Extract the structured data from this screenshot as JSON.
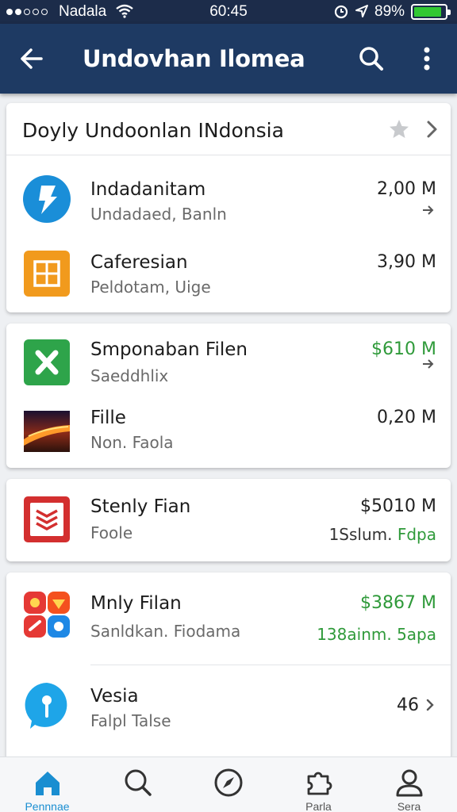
{
  "status_bar": {
    "carrier": "Nadala",
    "time": "60:45",
    "battery": "89%",
    "battery_level": 0.89,
    "battery_color": "#32c832"
  },
  "app_bar": {
    "title": "Undovhan Ilomea",
    "background": "#1e3a63",
    "icons": [
      "back-arrow-icon",
      "search-icon",
      "more-vert-icon"
    ]
  },
  "section": {
    "header": "Doyly Undoonlan INdonsia",
    "header_icons": [
      "star-icon",
      "chevron-right-icon"
    ]
  },
  "cards": [
    {
      "items": [
        {
          "icon": "lightning-app-icon",
          "name": "Indadanitam",
          "subtitle": "Undadaed, Banln",
          "value": "2,00 M",
          "trailing": "arrow-icon"
        },
        {
          "icon": "grid-app-icon",
          "name": "Caferesian",
          "subtitle": "Peldotam, Uige",
          "value": "3,90 M"
        }
      ]
    },
    {
      "items": [
        {
          "icon": "excel-app-icon",
          "name": "Smponaban Filen",
          "subtitle": "Saeddhlix",
          "value": "$610 M",
          "value_green": true,
          "trailing": "arrow-icon"
        },
        {
          "icon": "photo-thumbnail-icon",
          "name": "Fille",
          "subtitle": "Non. Faola",
          "value": "0,20 M"
        }
      ]
    },
    {
      "items": [
        {
          "icon": "document-app-icon",
          "name": "Stenly Fian",
          "subtitle": "Foole",
          "value": "$5010 M",
          "secondary_prefix": "1Sslum.",
          "secondary_green": "Fdpa"
        }
      ]
    },
    {
      "items": [
        {
          "icon": "multicolor-app-icon",
          "name": "Mnly Filan",
          "subtitle": "Sanldkan. Fiodama",
          "value": "$3867 M",
          "value_green": true,
          "secondary_green": "138ainm. 5apa"
        },
        {
          "icon": "pin-app-icon",
          "name": "Vesia",
          "subtitle": "Falpl Talse",
          "value": "46",
          "trailing": "chevron-right-icon"
        }
      ]
    }
  ],
  "bottom_nav": {
    "tabs": [
      {
        "label": "Pennnae",
        "icon": "home-icon",
        "active": true
      },
      {
        "label": "",
        "icon": "search-icon"
      },
      {
        "label": "",
        "icon": "compass-icon"
      },
      {
        "label": "Parla",
        "icon": "puzzle-icon"
      },
      {
        "label": "Sera",
        "icon": "person-icon"
      }
    ],
    "active_color": "#1a8ed1"
  }
}
